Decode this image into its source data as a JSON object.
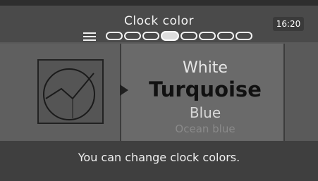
{
  "header": {
    "title": "Clock color",
    "time": "16:20",
    "page_count": 8,
    "active_page": 3
  },
  "options": {
    "items": [
      "White",
      "Turquoise",
      "Blue",
      "Ocean blue"
    ],
    "selected": "Turquoise"
  },
  "footer": {
    "hint": "You can change clock colors."
  },
  "icons": {
    "menu": "menu-icon",
    "arrow": "right-arrow-icon",
    "preview": "clock-preview-icon"
  }
}
